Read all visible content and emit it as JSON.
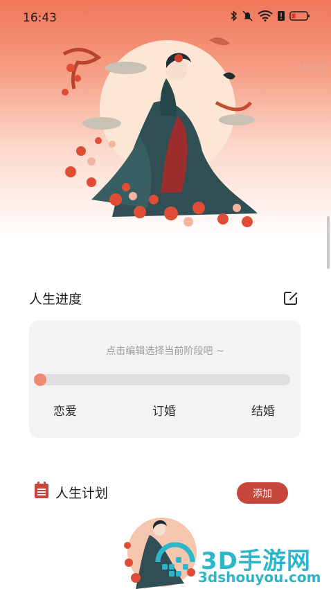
{
  "status_bar": {
    "time": "16:43",
    "icons": [
      "bluetooth-icon",
      "mute-icon",
      "wifi-icon",
      "alert-icon",
      "battery-icon"
    ]
  },
  "hero": {
    "background_code": "184c1",
    "image": "chinese-lady-moon-illustration"
  },
  "life_progress": {
    "title": "人生进度",
    "edit_icon": "edit-icon",
    "hint": "点击编辑选择当前阶段吧 ~",
    "progress": 0,
    "stages": [
      "恋爱",
      "订婚",
      "结婚"
    ]
  },
  "life_plan": {
    "title": "人生计划",
    "icon": "calendar-icon",
    "add_button": "添加"
  },
  "watermark": {
    "brand": "3D手游网",
    "url": "3dshouyou.com"
  },
  "colors": {
    "accent": "#c6463c",
    "progress_thumb": "#ee8a72",
    "hero_top": "#f0775b",
    "card_bg": "#f3f3f3",
    "watermark": "#2bb7c9"
  }
}
